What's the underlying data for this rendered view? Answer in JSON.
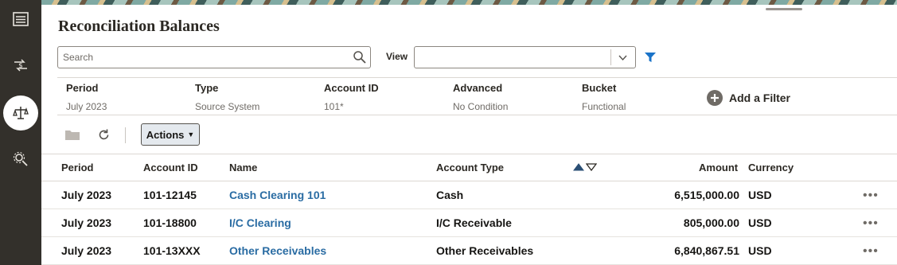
{
  "page": {
    "title": "Reconciliation Balances"
  },
  "toolbar": {
    "search_placeholder": "Search",
    "view_label": "View",
    "view_value": "",
    "actions_label": "Actions"
  },
  "filters": [
    {
      "label": "Period",
      "value": "July 2023"
    },
    {
      "label": "Type",
      "value": "Source System"
    },
    {
      "label": "Account ID",
      "value": "101*"
    },
    {
      "label": "Advanced",
      "value": "No Condition"
    },
    {
      "label": "Bucket",
      "value": "Functional"
    }
  ],
  "add_filter_label": "Add a Filter",
  "table": {
    "headers": {
      "period": "Period",
      "account_id": "Account ID",
      "name": "Name",
      "account_type": "Account Type",
      "amount": "Amount",
      "currency": "Currency"
    },
    "rows": [
      {
        "period": "July 2023",
        "account_id": "101-12145",
        "name": "Cash Clearing 101",
        "account_type": "Cash",
        "amount": "6,515,000.00",
        "currency": "USD"
      },
      {
        "period": "July 2023",
        "account_id": "101-18800",
        "name": "I/C Clearing",
        "account_type": "I/C Receivable",
        "amount": "805,000.00",
        "currency": "USD"
      },
      {
        "period": "July 2023",
        "account_id": "101-13XXX",
        "name": "Other Receivables",
        "account_type": "Other Receivables",
        "amount": "6,840,867.51",
        "currency": "USD"
      }
    ]
  },
  "rail_icons": [
    "list-icon",
    "currency-exchange-icon",
    "balance-scale-icon",
    "settings-search-icon"
  ],
  "colors": {
    "rail": "#33302b",
    "link": "#2a6ca3",
    "accent": "#1a73c8"
  }
}
